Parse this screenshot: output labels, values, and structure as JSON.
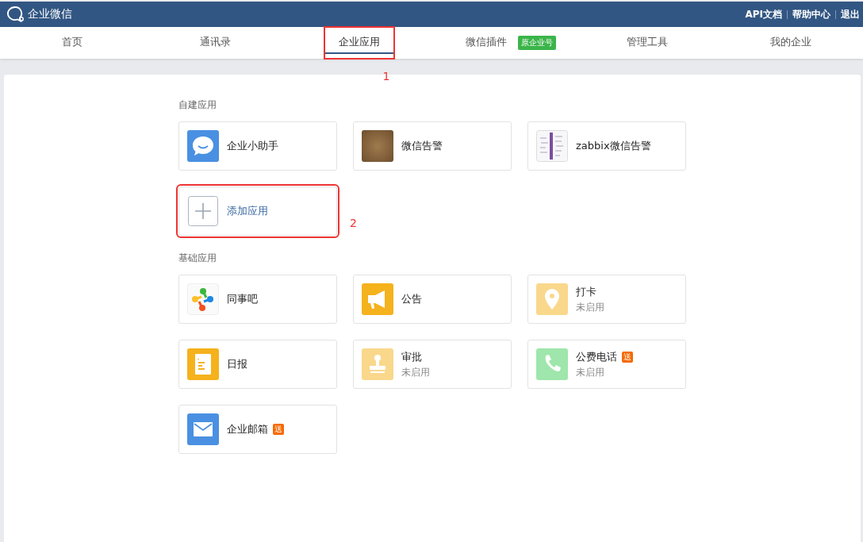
{
  "header": {
    "brand": "企业微信",
    "links": [
      "API文档",
      "帮助中心",
      "退出"
    ]
  },
  "tabs": [
    {
      "label": "首页",
      "selected": false
    },
    {
      "label": "通讯录",
      "selected": false
    },
    {
      "label": "企业应用",
      "selected": true,
      "annotation": "1"
    },
    {
      "label": "微信插件",
      "selected": false,
      "badge": "原企业号"
    },
    {
      "label": "管理工具",
      "selected": false
    },
    {
      "label": "我的企业",
      "selected": false
    }
  ],
  "sections": [
    {
      "title": "自建应用",
      "apps": [
        {
          "name": "企业小助手",
          "kind": "chat",
          "enabled": true
        },
        {
          "name": "微信告警",
          "kind": "photo",
          "enabled": true
        },
        {
          "name": "zabbix微信告警",
          "kind": "screenshot",
          "enabled": true
        },
        {
          "name": "添加应用",
          "kind": "add",
          "enabled": true,
          "annotation": "2"
        }
      ]
    },
    {
      "title": "基础应用",
      "apps": [
        {
          "name": "同事吧",
          "kind": "pinwheel",
          "enabled": true
        },
        {
          "name": "公告",
          "kind": "megaphone",
          "enabled": true
        },
        {
          "name": "打卡",
          "kind": "pin",
          "enabled": false,
          "status": "未启用"
        },
        {
          "name": "日报",
          "kind": "report",
          "enabled": true
        },
        {
          "name": "审批",
          "kind": "stamp",
          "enabled": false,
          "status": "未启用"
        },
        {
          "name": "公费电话",
          "kind": "phone",
          "enabled": false,
          "status": "未启用",
          "badge": "送"
        },
        {
          "name": "企业邮箱",
          "kind": "mail",
          "enabled": true,
          "badge": "送"
        }
      ]
    }
  ]
}
